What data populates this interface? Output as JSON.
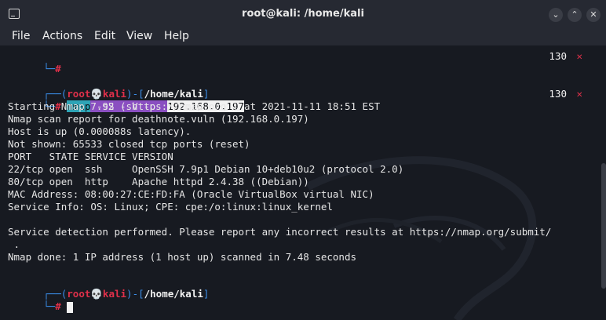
{
  "window": {
    "title": "root@kali: /home/kali"
  },
  "menu": {
    "items": [
      "File",
      "Actions",
      "Edit",
      "View",
      "Help"
    ]
  },
  "terminal": {
    "prev_line_status": "130",
    "prev_line_symbol": "✕",
    "prompt1": {
      "open": "┌──(",
      "user": "root💀kali",
      "sep": ")-[",
      "path": "/home/kali",
      "close": "]",
      "hash_prefix": "└─",
      "hash": "#"
    },
    "command": {
      "cmd": "nmap",
      "arg1": "-sS",
      "arg2": "-sV",
      "arg3": "-p-",
      "ip": "192.168.0.197"
    },
    "cmd_status": "130",
    "cmd_status_symbol": "✕",
    "output": [
      "Starting Nmap 7.92 ( https://nmap.org ) at 2021-11-11 18:51 EST",
      "Nmap scan report for deathnote.vuln (192.168.0.197)",
      "Host is up (0.000088s latency).",
      "Not shown: 65533 closed tcp ports (reset)",
      "PORT   STATE SERVICE VERSION",
      "22/tcp open  ssh     OpenSSH 7.9p1 Debian 10+deb10u2 (protocol 2.0)",
      "80/tcp open  http    Apache httpd 2.4.38 ((Debian))",
      "MAC Address: 08:00:27:CE:FD:FA (Oracle VirtualBox virtual NIC)",
      "Service Info: OS: Linux; CPE: cpe:/o:linux:linux_kernel",
      "",
      "Service detection performed. Please report any incorrect results at https://nmap.org/submit/",
      " .",
      "Nmap done: 1 IP address (1 host up) scanned in 7.48 seconds"
    ]
  },
  "colors": {
    "prompt_blue": "#3b8eea",
    "prompt_red": "#e0304a",
    "cmd_highlight": "#2fa4b6",
    "arg_highlight": "#8a4fc1"
  }
}
